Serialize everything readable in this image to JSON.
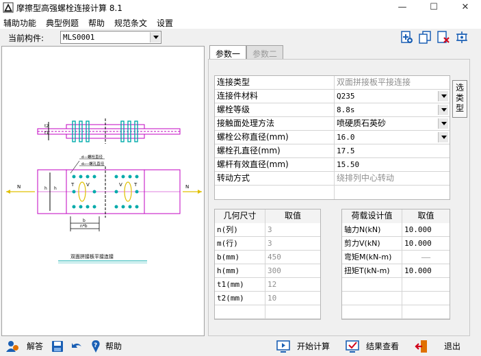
{
  "window": {
    "title": "摩擦型高强螺栓连接计算 8.1",
    "minimize": "—",
    "maximize": "☐",
    "close": "✕"
  },
  "menu": [
    "辅助功能",
    "典型例题",
    "帮助",
    "规范条文",
    "设置"
  ],
  "component": {
    "label": "当前构件:",
    "value": "MLS0001"
  },
  "toolbar_icons": [
    "add-page-icon",
    "copy-icon",
    "delete-icon",
    "tool-icon"
  ],
  "tabs": [
    {
      "label": "参数一",
      "active": true
    },
    {
      "label": "参数二",
      "active": false
    }
  ],
  "params": [
    {
      "label": "连接类型",
      "value": "双面拼接板平接连接",
      "dropdown": false,
      "gray": true
    },
    {
      "label": "连接件材料",
      "value": "Q235",
      "dropdown": true,
      "gray": false
    },
    {
      "label": "螺栓等级",
      "value": "8.8s",
      "dropdown": true,
      "gray": false
    },
    {
      "label": "接触面处理方法",
      "value": "喷硬质石英砂",
      "dropdown": true,
      "gray": false
    },
    {
      "label": "螺栓公称直径(mm)",
      "value": "16.0",
      "dropdown": true,
      "gray": false
    },
    {
      "label": "螺栓孔直径(mm)",
      "value": "17.5",
      "dropdown": false,
      "gray": false
    },
    {
      "label": "螺杆有效直径(mm)",
      "value": "15.50",
      "dropdown": false,
      "gray": false
    },
    {
      "label": "转动方式",
      "value": "绕排列中心转动",
      "dropdown": false,
      "gray": true
    }
  ],
  "choose_button": "选类型",
  "geometry": {
    "headers": [
      "几何尺寸",
      "取值"
    ],
    "rows": [
      {
        "label": "n(列)",
        "value": "3"
      },
      {
        "label": "m(行)",
        "value": "3"
      },
      {
        "label": "b(mm)",
        "value": "450"
      },
      {
        "label": "h(mm)",
        "value": "300"
      },
      {
        "label": "t1(mm)",
        "value": "12"
      },
      {
        "label": "t2(mm)",
        "value": "10"
      }
    ]
  },
  "loads": {
    "headers": [
      "荷载设计值",
      "取值"
    ],
    "rows": [
      {
        "label": "轴力N(kN)",
        "value": "10.000"
      },
      {
        "label": "剪力V(kN)",
        "value": "10.000"
      },
      {
        "label": "弯矩M(kN-m)",
        "value": "——"
      },
      {
        "label": "扭矩T(kN-m)",
        "value": "10.000"
      }
    ]
  },
  "drawing": {
    "caption": "双面拼接板平接连接",
    "labels": {
      "N_left": "N",
      "N_right": "N",
      "d_label": "d—螺栓直径",
      "d0_label": "d₀—螺孔直径",
      "b": "b",
      "n_b": "n*b",
      "h": "h",
      "h_dim": "h",
      "t1": "t1",
      "t2": "t2",
      "V_left": "V",
      "V_right": "V",
      "T_left": "T",
      "T_right": "T"
    }
  },
  "bottom": {
    "answer": "解答",
    "help": "帮助",
    "start": "开始计算",
    "results": "结果查看",
    "exit": "退出"
  }
}
